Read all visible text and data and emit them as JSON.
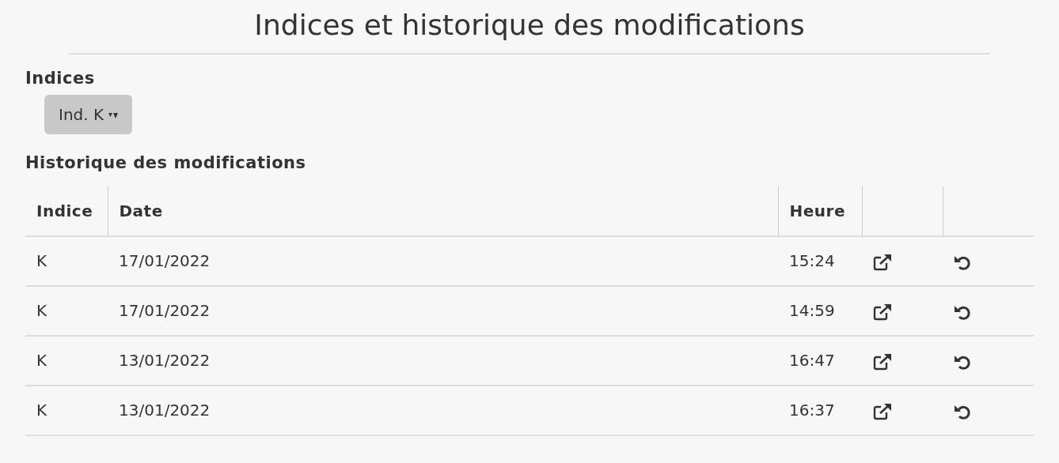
{
  "title": "Indices et historique des modifications",
  "indices": {
    "heading": "Indices",
    "dropdown": {
      "label": "Ind. K"
    }
  },
  "history": {
    "heading": "Historique des modifications",
    "columns": [
      "Indice",
      "Date",
      "Heure"
    ],
    "rows": [
      {
        "indice": "K",
        "date": "17/01/2022",
        "heure": "15:24"
      },
      {
        "indice": "K",
        "date": "17/01/2022",
        "heure": "14:59"
      },
      {
        "indice": "K",
        "date": "13/01/2022",
        "heure": "16:47"
      },
      {
        "indice": "K",
        "date": "13/01/2022",
        "heure": "16:37"
      }
    ]
  }
}
